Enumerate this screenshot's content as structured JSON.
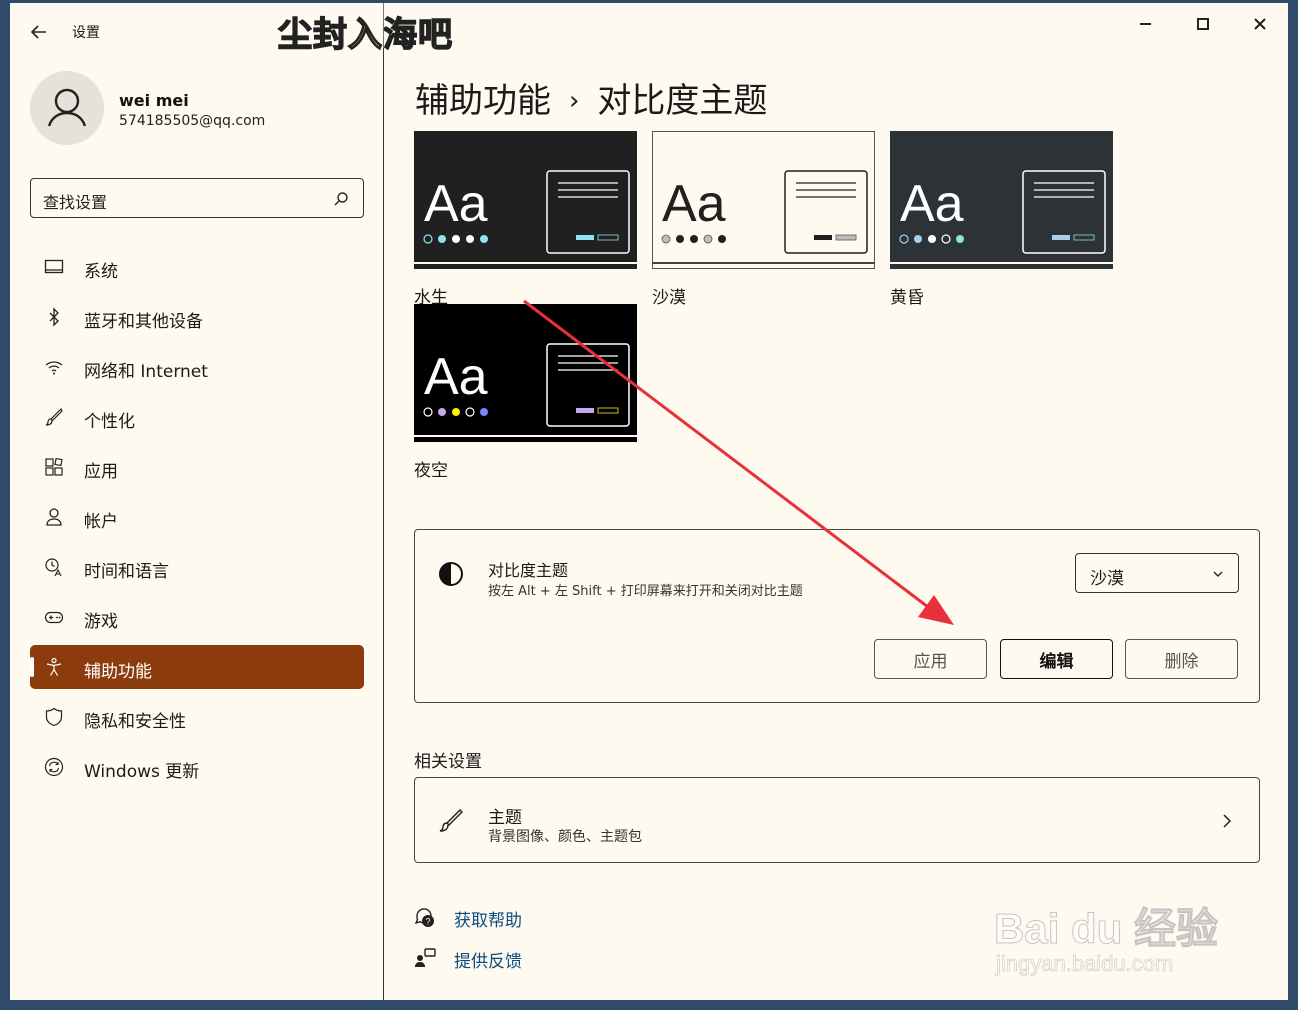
{
  "window": {
    "app_title": "设置",
    "overlay_title": "尘封入海吧"
  },
  "user": {
    "name": "wei mei",
    "email": "574185505@qq.com"
  },
  "search": {
    "placeholder": "查找设置"
  },
  "nav": {
    "items": [
      {
        "label": "系统",
        "icon": "monitor-icon"
      },
      {
        "label": "蓝牙和其他设备",
        "icon": "bluetooth-icon"
      },
      {
        "label": "网络和 Internet",
        "icon": "wifi-icon"
      },
      {
        "label": "个性化",
        "icon": "brush-icon"
      },
      {
        "label": "应用",
        "icon": "apps-icon"
      },
      {
        "label": "帐户",
        "icon": "person-icon"
      },
      {
        "label": "时间和语言",
        "icon": "clock-language-icon"
      },
      {
        "label": "游戏",
        "icon": "gamepad-icon"
      },
      {
        "label": "辅助功能",
        "icon": "accessibility-icon",
        "active": true
      },
      {
        "label": "隐私和安全性",
        "icon": "shield-icon"
      },
      {
        "label": "Windows 更新",
        "icon": "refresh-icon"
      }
    ],
    "active_color": "#8c3b0c"
  },
  "breadcrumb": {
    "parent": "辅助功能",
    "current": "对比度主题"
  },
  "themes": [
    {
      "name": "水生",
      "sample": "Aa",
      "bg": "#202020",
      "accent": "#8ee3f0",
      "dots": [
        "#8ee3f0",
        "#8ee3f0",
        "#ffffff",
        "#ffffff",
        "#8ee3f0"
      ]
    },
    {
      "name": "沙漠",
      "sample": "Aa",
      "bg": "#fffaef",
      "accent": "#202020",
      "dots": [
        "#bdbdbd",
        "#202020",
        "#202020",
        "#bdbdbd",
        "#202020"
      ]
    },
    {
      "name": "黄昏",
      "sample": "Aa",
      "bg": "#2d3236",
      "accent": "#a6cff0",
      "dots": [
        "#a6cff0",
        "#a6cff0",
        "#ffffff",
        "#2d3236",
        "#8ee3d2"
      ]
    },
    {
      "name": "夜空",
      "sample": "Aa",
      "bg": "#000000",
      "accent": "#c5a8f0",
      "dots": [
        "#000000",
        "#c5a8f0",
        "#fff200",
        "#000000",
        "#8080ff"
      ]
    }
  ],
  "contrast_panel": {
    "title": "对比度主题",
    "description": "按左 Alt + 左 Shift + 打印屏幕来打开和关闭对比主题",
    "selected": "沙漠",
    "buttons": {
      "apply": "应用",
      "edit": "编辑",
      "delete": "删除"
    }
  },
  "related": {
    "title": "相关设置",
    "theme_row": {
      "title": "主题",
      "description": "背景图像、颜色、主题包"
    }
  },
  "help": {
    "get_help": "获取帮助",
    "feedback": "提供反馈"
  },
  "watermark": {
    "brand": "Bai du 经验",
    "url": "jingyan.baidu.com"
  },
  "annotation_color": "#e8303a"
}
